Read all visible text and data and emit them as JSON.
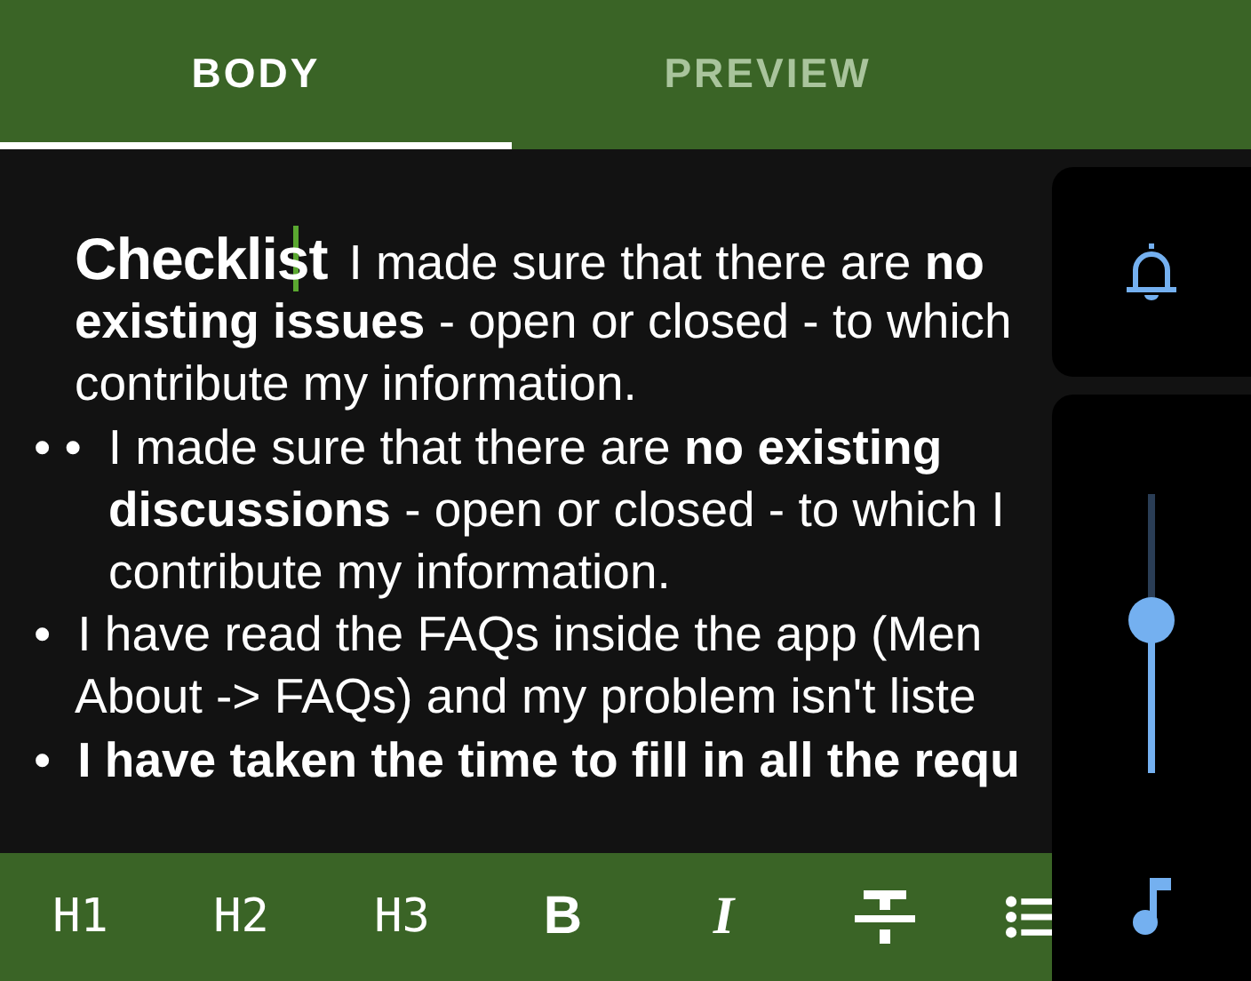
{
  "tabs": [
    {
      "label": "BODY",
      "selected": true
    },
    {
      "label": "PREVIEW",
      "selected": false
    }
  ],
  "editor": {
    "lines": [
      {
        "kind": "heading",
        "heading": "Checklist",
        "text": "I made sure that there are **no**",
        "bold": false
      },
      {
        "kind": "plain",
        "text": "**existing issues** - open or closed - to which",
        "bold": false
      },
      {
        "kind": "plain",
        "text": "contribute my information.",
        "bold": false
      },
      {
        "kind": "bullet",
        "bullet": "• •",
        "text": "I made sure that there are **no existing**",
        "bold": false
      },
      {
        "kind": "indented",
        "text": "**discussions** - open or closed - to which I",
        "bold": false
      },
      {
        "kind": "indented",
        "text": "contribute my information.",
        "bold": false
      },
      {
        "kind": "bullet",
        "bullet": "•",
        "text": "I have read the FAQs inside the app (Men",
        "bold": false
      },
      {
        "kind": "plain",
        "text": "About -> FAQs) and my problem isn't liste",
        "bold": false
      },
      {
        "kind": "bullet",
        "bullet": "•",
        "text": "I have taken the time to fill in all the requ",
        "bold": true
      }
    ]
  },
  "toolbar": [
    {
      "kind": "text",
      "label": "H1"
    },
    {
      "kind": "text",
      "label": "H2"
    },
    {
      "kind": "text",
      "label": "H3"
    },
    {
      "kind": "bold",
      "label": "B"
    },
    {
      "kind": "italic",
      "label": "I"
    },
    {
      "kind": "strikethrough"
    },
    {
      "kind": "list"
    }
  ],
  "volume": {
    "level": 0.55
  }
}
